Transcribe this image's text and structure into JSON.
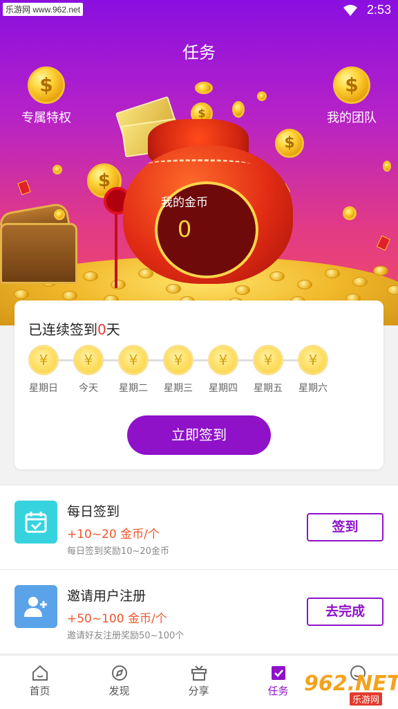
{
  "status_bar": {
    "watermark": "乐游网 www.962.net",
    "time": "2:53",
    "wifi_icon": "wifi-icon"
  },
  "header": {
    "title": "任务",
    "left_item": {
      "label": "专属特权",
      "icon": "dollar-coin-icon"
    },
    "right_item": {
      "label": "我的团队",
      "icon": "dollar-coin-icon"
    }
  },
  "gold": {
    "label": "我的金币",
    "value": "0"
  },
  "signin": {
    "streak_prefix": "已连续签到",
    "streak_days": "0",
    "streak_suffix": "天",
    "coin_symbol": "¥",
    "days": [
      {
        "label": "星期日"
      },
      {
        "label": "今天"
      },
      {
        "label": "星期二"
      },
      {
        "label": "星期三"
      },
      {
        "label": "星期四"
      },
      {
        "label": "星期五"
      },
      {
        "label": "星期六"
      }
    ],
    "button_label": "立即签到",
    "accent_color": "#8f12c9"
  },
  "tasks": [
    {
      "title": "每日签到",
      "reward": "+10~20 金币/个",
      "desc": "每日签到奖励10~20金币",
      "button": "签到",
      "icon": "calendar-check-icon",
      "icon_color": "#36d3df"
    },
    {
      "title": "邀请用户注册",
      "reward": "+50~100 金币/个",
      "desc": "邀请好友注册奖励50~100个",
      "button": "去完成",
      "icon": "add-user-icon",
      "icon_color": "#5aa3e8"
    }
  ],
  "nav": [
    {
      "label": "首页",
      "icon": "home-icon",
      "active": false
    },
    {
      "label": "发现",
      "icon": "compass-icon",
      "active": false
    },
    {
      "label": "分享",
      "icon": "gift-box-icon",
      "active": false
    },
    {
      "label": "任务",
      "icon": "task-check-icon",
      "active": true
    },
    {
      "label": "",
      "icon": "profile-icon",
      "active": false
    }
  ],
  "watermark_br": {
    "logo": "962.NET",
    "text": "乐游网"
  }
}
